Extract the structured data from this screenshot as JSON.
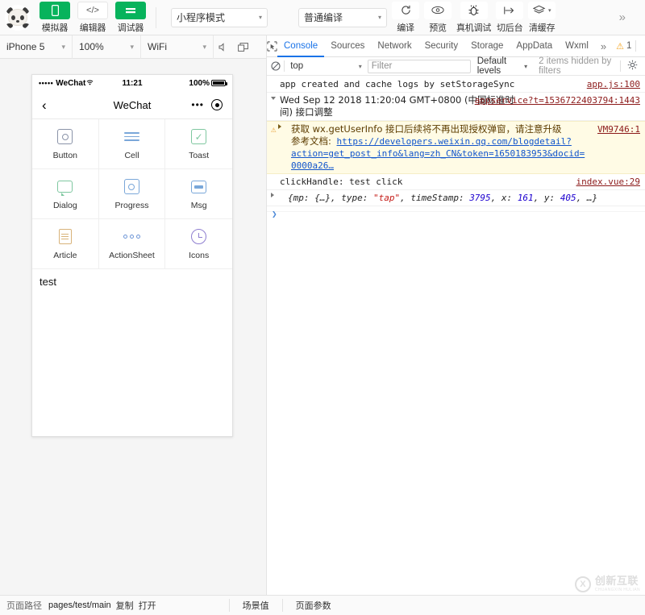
{
  "toolbar": {
    "logo_name": "wechat-devtools-panda-logo",
    "buttons": [
      {
        "label": "模拟器",
        "icon": "phone-icon",
        "style": "green"
      },
      {
        "label": "编辑器",
        "icon": "code-icon",
        "style": "white"
      },
      {
        "label": "调试器",
        "icon": "debug-icon",
        "style": "green"
      }
    ],
    "mode_select": {
      "value": "小程序模式",
      "caret": "▾"
    },
    "compile_select": {
      "value": "普通编译",
      "caret": "▾"
    },
    "actions": [
      {
        "label": "编译",
        "icon": "refresh-icon",
        "glyph": "↻"
      },
      {
        "label": "预览",
        "icon": "eye-icon",
        "glyph": "👁"
      },
      {
        "label": "真机调试",
        "icon": "bug-icon",
        "glyph": "🐞"
      },
      {
        "label": "切后台",
        "icon": "background-switch-icon",
        "glyph": "↦"
      },
      {
        "label": "清缓存",
        "icon": "layers-icon",
        "glyph": "≋"
      }
    ],
    "overflow": "»"
  },
  "simulator_bar": {
    "device": "iPhone 5",
    "zoom": "100%",
    "network": "WiFi",
    "caret": "▾",
    "sound_icon": "volume-icon",
    "screen_icon": "window-icon"
  },
  "simulator": {
    "status_bar": {
      "signal_dots": "•••••",
      "carrier": "WeChat",
      "wifi": "≋",
      "time": "11:21",
      "battery_text": "100%"
    },
    "nav": {
      "back": "‹",
      "title": "WeChat",
      "capsule_dots": "•••",
      "capsule_target": "target-icon"
    },
    "grid": [
      {
        "label": "Button",
        "icon": "button-icon",
        "color": "#8a93a8"
      },
      {
        "label": "Cell",
        "icon": "cell-icon",
        "color": "#7aa7d9"
      },
      {
        "label": "Toast",
        "icon": "toast-icon",
        "color": "#7fc7a0"
      },
      {
        "label": "Dialog",
        "icon": "dialog-icon",
        "color": "#7fc7a0"
      },
      {
        "label": "Progress",
        "icon": "progress-icon",
        "color": "#7aa7d9"
      },
      {
        "label": "Msg",
        "icon": "msg-icon",
        "color": "#7aa7d9"
      },
      {
        "label": "Article",
        "icon": "article-icon",
        "color": "#d8b37a"
      },
      {
        "label": "ActionSheet",
        "icon": "actionsheet-icon",
        "color": "#6d95d6"
      },
      {
        "label": "Icons",
        "icon": "icons-clock-icon",
        "color": "#8f7fd0"
      }
    ],
    "page_text": "test"
  },
  "devtools": {
    "inspect_icon": "inspect-element-icon",
    "tabs": [
      {
        "label": "Console",
        "active": true
      },
      {
        "label": "Sources",
        "active": false
      },
      {
        "label": "Network",
        "active": false
      },
      {
        "label": "Security",
        "active": false
      },
      {
        "label": "Storage",
        "active": false
      },
      {
        "label": "AppData",
        "active": false
      },
      {
        "label": "Wxml",
        "active": false
      }
    ],
    "tabs_overflow": "»",
    "warning_icon": "warning-triangle-icon",
    "warning_count": "1",
    "kebab": "⋮",
    "dock_icon": "dock-panel-icon",
    "filter_bar": {
      "clear_icon": "clear-console-icon",
      "context": "top",
      "context_caret": "▾",
      "filter_placeholder": "Filter",
      "filter_value": "",
      "levels": "Default levels",
      "levels_caret": "▾",
      "hidden_note": "2 items hidden by filters",
      "settings_icon": "settings-gear-icon"
    },
    "logs": [
      {
        "type": "log",
        "text": "app created and cache logs by setStorageSync",
        "source": "app.js:100"
      },
      {
        "type": "group",
        "triangle": "▾",
        "text": "Wed Sep 12 2018 11:20:04 GMT+0800 (中国标准时间) 接口调整",
        "source": "appservice?t=1536722403794:1443"
      },
      {
        "type": "warning",
        "triangle": "▸",
        "text": "获取 wx.getUserInfo 接口后续将不再出现授权弹窗，请注意升级",
        "doc_label": "参考文档:",
        "doc_url": "https://developers.weixin.qq.com/blogdetail?action=get_post_info&lang=zh_CN&token=1650183953&docid=0000a26…",
        "source": "VM9746:1"
      },
      {
        "type": "log",
        "text": "clickHandle: test click",
        "source": "index.vue:29"
      },
      {
        "type": "object",
        "triangle": "▸",
        "prefix": "{mp: {…}, type: ",
        "str_value": "\"tap\"",
        "mid": ", timeStamp: ",
        "num1": "3795",
        "mid2": ", x: ",
        "num2": "161",
        "mid3": ", y: ",
        "num3": "405",
        "suffix": ", …}"
      }
    ],
    "prompt_arrow": "❯"
  },
  "bottom_bar": {
    "path_label": "页面路径",
    "path_value": "pages/test/main",
    "copy": "复制",
    "open": "打开",
    "scene_value": "场景值",
    "page_params": "页面参数"
  },
  "watermark": {
    "mark": "X",
    "cn": "创新互联",
    "en": "CHUANGXIN HULIAN"
  }
}
